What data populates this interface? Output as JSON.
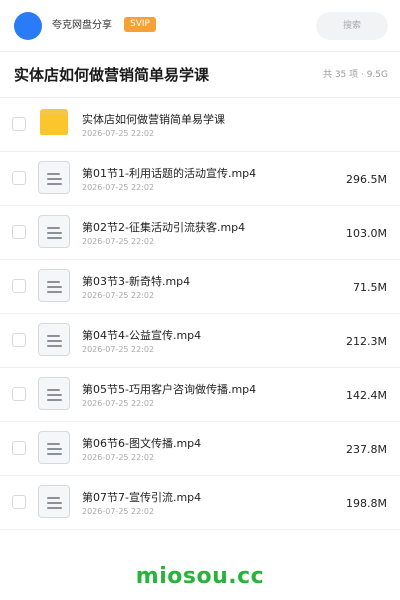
{
  "header": {
    "share_name": "夸克网盘分享",
    "badge": "SVIP",
    "search_placeholder": "搜索"
  },
  "folder": {
    "title": "实体店如何做营销简单易学课",
    "meta": "共 35 项 · 9.5G"
  },
  "files": [
    {
      "type": "folder",
      "name": "实体店如何做营销简单易学课",
      "date": "2026-07-25 22:02",
      "size": ""
    },
    {
      "type": "file",
      "name": "第01节1-利用话题的活动宣传.mp4",
      "date": "2026-07-25 22:02",
      "size": "296.5M"
    },
    {
      "type": "file",
      "name": "第02节2-征集活动引流获客.mp4",
      "date": "2026-07-25 22:02",
      "size": "103.0M"
    },
    {
      "type": "file",
      "name": "第03节3-新奇特.mp4",
      "date": "2026-07-25 22:02",
      "size": "71.5M"
    },
    {
      "type": "file",
      "name": "第04节4-公益宣传.mp4",
      "date": "2026-07-25 22:02",
      "size": "212.3M"
    },
    {
      "type": "file",
      "name": "第05节5-巧用客户咨询做传播.mp4",
      "date": "2026-07-25 22:02",
      "size": "142.4M"
    },
    {
      "type": "file",
      "name": "第06节6-图文传播.mp4",
      "date": "2026-07-25 22:02",
      "size": "237.8M"
    },
    {
      "type": "file",
      "name": "第07节7-宣传引流.mp4",
      "date": "2026-07-25 22:02",
      "size": "198.8M"
    }
  ],
  "watermark": "miosou.cc",
  "colors": {
    "accent_blue": "#2a7bf6",
    "svip_orange": "#f7a033",
    "folder_yellow": "#fbc52c",
    "watermark_green": "#27b43a"
  },
  "icons": {
    "folder": "folder-icon",
    "file": "video-file-icon"
  }
}
